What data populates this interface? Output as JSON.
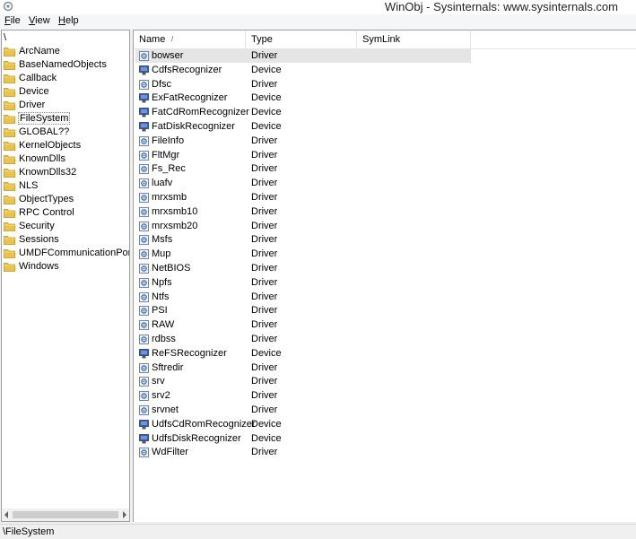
{
  "window": {
    "title": "WinObj - Sysinternals: www.sysinternals.com"
  },
  "menu": [
    {
      "label": "File",
      "accel": "F",
      "rest": "ile"
    },
    {
      "label": "View",
      "accel": "V",
      "rest": "iew"
    },
    {
      "label": "Help",
      "accel": "H",
      "rest": "elp"
    }
  ],
  "tree": {
    "root": "\\",
    "items": [
      "ArcName",
      "BaseNamedObjects",
      "Callback",
      "Device",
      "Driver",
      "FileSystem",
      "GLOBAL??",
      "KernelObjects",
      "KnownDlls",
      "KnownDlls32",
      "NLS",
      "ObjectTypes",
      "RPC Control",
      "Security",
      "Sessions",
      "UMDFCommunicationPorts",
      "Windows"
    ],
    "selected": "FileSystem"
  },
  "list": {
    "columns": [
      "Name",
      "Type",
      "SymLink"
    ],
    "sort_indicator": "/",
    "rows": [
      {
        "name": "bowser",
        "type": "Driver",
        "icon": "driver-icon"
      },
      {
        "name": "CdfsRecognizer",
        "type": "Device",
        "icon": "device-icon"
      },
      {
        "name": "Dfsc",
        "type": "Driver",
        "icon": "driver-icon"
      },
      {
        "name": "ExFatRecognizer",
        "type": "Device",
        "icon": "device-icon"
      },
      {
        "name": "FatCdRomRecognizer",
        "type": "Device",
        "icon": "device-icon"
      },
      {
        "name": "FatDiskRecognizer",
        "type": "Device",
        "icon": "device-icon"
      },
      {
        "name": "FileInfo",
        "type": "Driver",
        "icon": "driver-icon"
      },
      {
        "name": "FltMgr",
        "type": "Driver",
        "icon": "driver-icon"
      },
      {
        "name": "Fs_Rec",
        "type": "Driver",
        "icon": "driver-icon"
      },
      {
        "name": "luafv",
        "type": "Driver",
        "icon": "driver-icon"
      },
      {
        "name": "mrxsmb",
        "type": "Driver",
        "icon": "driver-icon"
      },
      {
        "name": "mrxsmb10",
        "type": "Driver",
        "icon": "driver-icon"
      },
      {
        "name": "mrxsmb20",
        "type": "Driver",
        "icon": "driver-icon"
      },
      {
        "name": "Msfs",
        "type": "Driver",
        "icon": "driver-icon"
      },
      {
        "name": "Mup",
        "type": "Driver",
        "icon": "driver-icon"
      },
      {
        "name": "NetBIOS",
        "type": "Driver",
        "icon": "driver-icon"
      },
      {
        "name": "Npfs",
        "type": "Driver",
        "icon": "driver-icon"
      },
      {
        "name": "Ntfs",
        "type": "Driver",
        "icon": "driver-icon"
      },
      {
        "name": "PSI",
        "type": "Driver",
        "icon": "driver-icon"
      },
      {
        "name": "RAW",
        "type": "Driver",
        "icon": "driver-icon"
      },
      {
        "name": "rdbss",
        "type": "Driver",
        "icon": "driver-icon"
      },
      {
        "name": "ReFSRecognizer",
        "type": "Device",
        "icon": "device-icon"
      },
      {
        "name": "Sftredir",
        "type": "Driver",
        "icon": "driver-icon"
      },
      {
        "name": "srv",
        "type": "Driver",
        "icon": "driver-icon"
      },
      {
        "name": "srv2",
        "type": "Driver",
        "icon": "driver-icon"
      },
      {
        "name": "srvnet",
        "type": "Driver",
        "icon": "driver-icon"
      },
      {
        "name": "UdfsCdRomRecognizer",
        "type": "Device",
        "icon": "device-icon"
      },
      {
        "name": "UdfsDiskRecognizer",
        "type": "Device",
        "icon": "device-icon"
      },
      {
        "name": "WdFilter",
        "type": "Driver",
        "icon": "driver-icon"
      }
    ]
  },
  "status": {
    "path": "\\FileSystem"
  },
  "colors": {
    "folder": "#e8c44a",
    "selection": "#e5e5e5",
    "border": "#a0a0a0"
  }
}
